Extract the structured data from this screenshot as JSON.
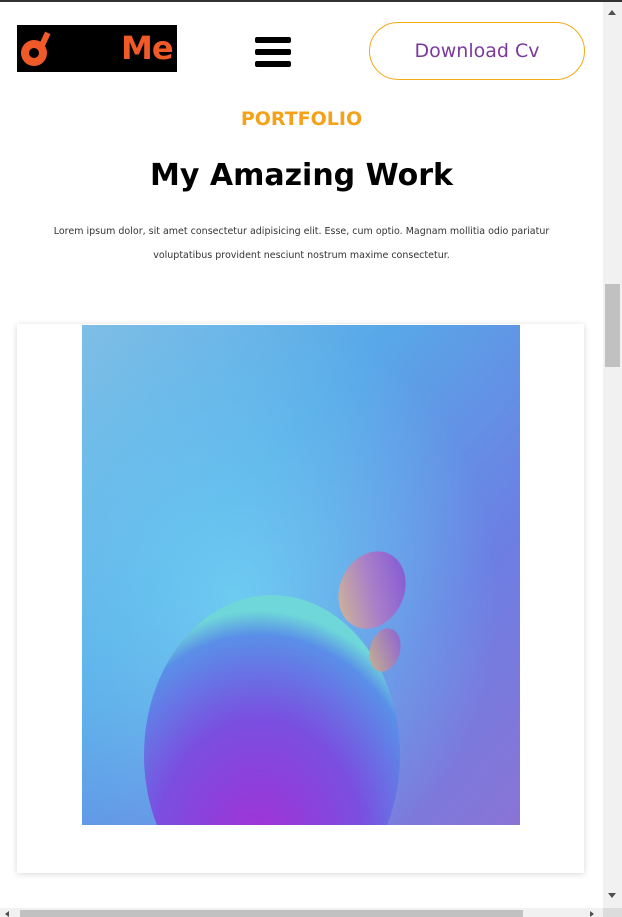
{
  "header": {
    "logo_text": "Me",
    "menu_icon": "hamburger-menu-icon",
    "download_label": "Download Cv"
  },
  "portfolio": {
    "eyebrow": "PORTFOLIO",
    "title": "My Amazing Work",
    "description_line1": "Lorem ipsum dolor, sit amet consectetur adipisicing elit. Esse, cum optio. Magnam mollitia odio pariatur",
    "description_line2": "voluptatibus provident nesciunt nostrum maxime consectetur."
  },
  "colors": {
    "accent_orange": "#f5a21a",
    "logo_orange": "#f05a28",
    "button_text": "#7b3a9e"
  }
}
